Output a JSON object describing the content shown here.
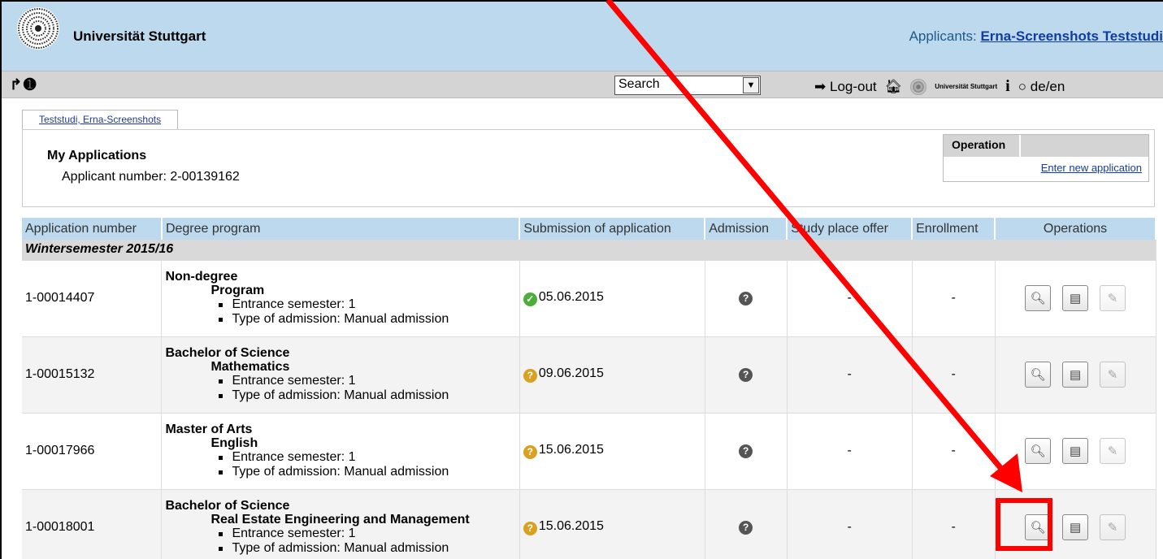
{
  "header": {
    "university": "Universität Stuttgart",
    "applicants_label": "Applicants:",
    "applicant_name": "Erna-Screenshots Teststudi"
  },
  "toolbar": {
    "search_value": "Search",
    "logout_label": "Log-out",
    "uni_small": "Universität Stuttgart",
    "language_label": "de/en"
  },
  "tab": {
    "label": "Teststudi, Erna-Screenshots"
  },
  "panel": {
    "title": "My Applications",
    "applicant_number": "Applicant number: 2-00139162",
    "operation_header": "Operation",
    "enter_new_application": "Enter new application"
  },
  "table": {
    "headers": [
      "Application number",
      "Degree program",
      "Submission of application",
      "Admission",
      "Study place offer",
      "Enrollment",
      "Operations"
    ],
    "semester": "Wintersemester 2015/16",
    "rows": [
      {
        "number": "1-00014407",
        "degree": "Non-degree",
        "program": "Program",
        "entrance": "Entrance semester: 1",
        "type": "Type of admission: Manual admission",
        "status": "ok",
        "date": "05.06.2015",
        "offer": "-",
        "enrollment": "-"
      },
      {
        "number": "1-00015132",
        "degree": "Bachelor of Science",
        "program": "Mathematics",
        "entrance": "Entrance semester: 1",
        "type": "Type of admission: Manual admission",
        "status": "pending",
        "date": "09.06.2015",
        "offer": "-",
        "enrollment": "-"
      },
      {
        "number": "1-00017966",
        "degree": "Master of Arts",
        "program": "English",
        "entrance": "Entrance semester: 1",
        "type": "Type of admission: Manual admission",
        "status": "pending",
        "date": "15.06.2015",
        "offer": "-",
        "enrollment": "-"
      },
      {
        "number": "1-00018001",
        "degree": "Bachelor of Science",
        "program": "Real Estate Engineering and Management",
        "entrance": "Entrance semester: 1",
        "type": "Type of admission: Manual admission",
        "status": "pending",
        "date": "15.06.2015",
        "offer": "-",
        "enrollment": "-"
      }
    ]
  },
  "colors": {
    "header_bg": "#bcd9ee",
    "annotation": "#ff0000"
  },
  "icons": [
    "university-logo-icon",
    "forward-icon",
    "play-icon",
    "logout-icon",
    "home-icon",
    "info-icon",
    "speech-bubble-icon",
    "check-icon",
    "question-icon",
    "magnifier-icon",
    "document-icon",
    "pencil-icon"
  ]
}
